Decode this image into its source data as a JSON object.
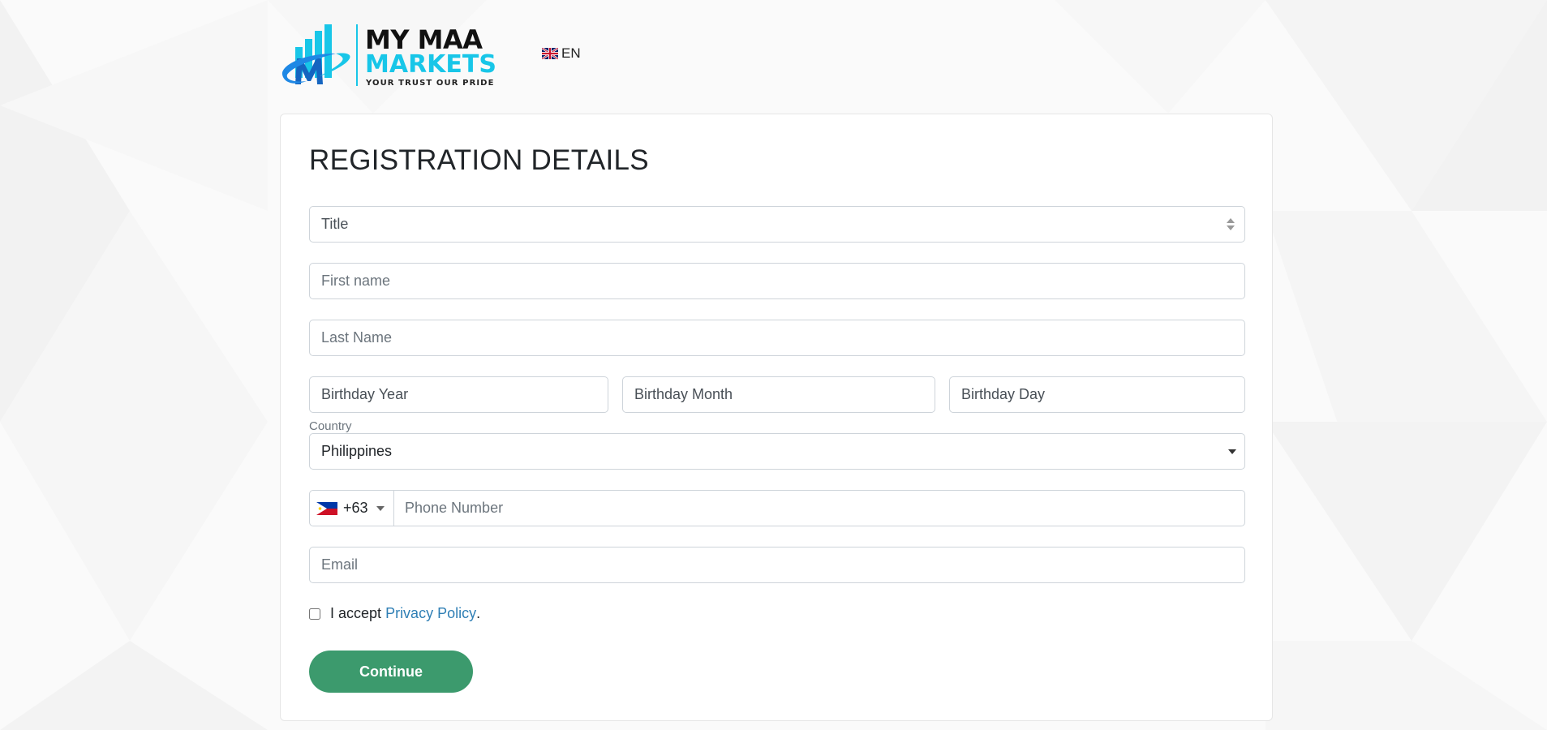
{
  "brand": {
    "name_line1": "MY MAA",
    "name_line2": "MARKETS",
    "tagline": "YOUR TRUST OUR PRIDE",
    "colors": {
      "primary": "#18c6e8",
      "dark": "#1565c0",
      "text": "#111111"
    }
  },
  "header": {
    "language": {
      "code": "EN",
      "flag_icon": "uk-flag-icon"
    }
  },
  "form": {
    "title": "REGISTRATION DETAILS",
    "title_select": {
      "value": "Title"
    },
    "first_name": {
      "placeholder": "First name",
      "value": ""
    },
    "last_name": {
      "placeholder": "Last Name",
      "value": ""
    },
    "birthday_year": {
      "value": "Birthday Year"
    },
    "birthday_month": {
      "value": "Birthday Month"
    },
    "birthday_day": {
      "value": "Birthday Day"
    },
    "country": {
      "label": "Country",
      "value": "Philippines"
    },
    "phone": {
      "dial_code": "+63",
      "flag_icon": "philippines-flag-icon",
      "placeholder": "Phone Number",
      "value": ""
    },
    "email": {
      "placeholder": "Email",
      "value": ""
    },
    "accept": {
      "prefix": "I accept",
      "link_text": "Privacy Policy",
      "suffix": ".",
      "checked": false
    },
    "continue_label": "Continue"
  },
  "colors": {
    "button": "#3c9a6d",
    "link": "#2f7fb5",
    "border": "#ced4da",
    "background": "#f9f9f9"
  }
}
